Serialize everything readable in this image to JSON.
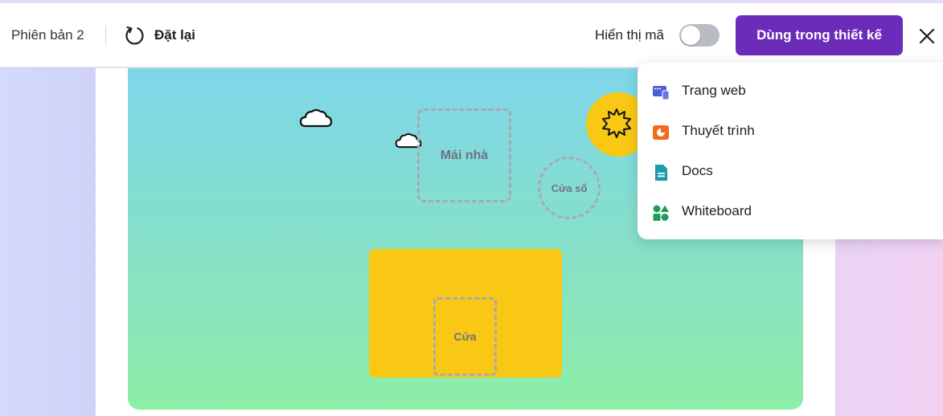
{
  "toolbar": {
    "version_label": "Phiên bản 2",
    "reset_label": "Đặt lại",
    "show_code_label": "Hiển thị mã",
    "show_code_on": false,
    "use_in_design_label": "Dùng trong thiết kế",
    "accent_color": "#6c2bb8"
  },
  "canvas": {
    "roof_label": "Mái nhà",
    "window_label": "Cửa sổ",
    "door_label": "Cửa",
    "sun_color": "#f8c814",
    "house_color": "#f8c814"
  },
  "menu": {
    "items": [
      {
        "label": "Trang web",
        "icon": "website-icon",
        "color": "#4f5bd5"
      },
      {
        "label": "Thuyết trình",
        "icon": "presentation-icon",
        "color": "#f26a1b"
      },
      {
        "label": "Docs",
        "icon": "docs-icon",
        "color": "#1a9bb0"
      },
      {
        "label": "Whiteboard",
        "icon": "whiteboard-icon",
        "color": "#1e9e5a"
      }
    ]
  }
}
